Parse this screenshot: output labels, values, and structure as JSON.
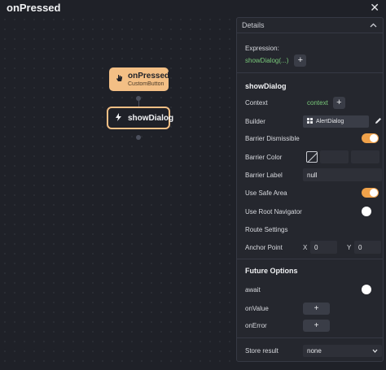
{
  "window": {
    "title": "onPressed",
    "close_glyph": "✕"
  },
  "canvas": {
    "trigger_node": {
      "title": "onPressed",
      "subtitle": "CustomButton",
      "icon": "hand-icon"
    },
    "action_node": {
      "label": "showDialog",
      "icon": "lightning-icon"
    }
  },
  "panel": {
    "header": "Details",
    "expression_label": "Expression:",
    "expression_value": "showDialog(...)",
    "action_title": "showDialog",
    "context_label": "Context",
    "context_value": "context",
    "builder_label": "Builder",
    "builder_value": "AlertDialog",
    "barrier_dismissible_label": "Barrier Dismissible",
    "barrier_dismissible_on": true,
    "barrier_color_label": "Barrier Color",
    "barrier_label_label": "Barrier Label",
    "barrier_label_value": "null",
    "use_safe_area_label": "Use Safe Area",
    "use_safe_area_on": true,
    "use_root_navigator_label": "Use Root Navigator",
    "use_root_navigator_on": false,
    "route_settings_label": "Route Settings",
    "anchor_point_label": "Anchor Point",
    "anchor_x_label": "X",
    "anchor_x_value": "0",
    "anchor_y_label": "Y",
    "anchor_y_value": "0",
    "future_options_title": "Future Options",
    "await_label": "await",
    "await_on": false,
    "on_value_label": "onValue",
    "on_error_label": "onError",
    "store_result_label": "Store result",
    "store_result_value": "none"
  },
  "colors": {
    "accent": "#f3bf85",
    "toggle_on": "#f0a24a",
    "context_green": "#79c97a",
    "background": "#1f2128",
    "panel": "#25272e"
  }
}
